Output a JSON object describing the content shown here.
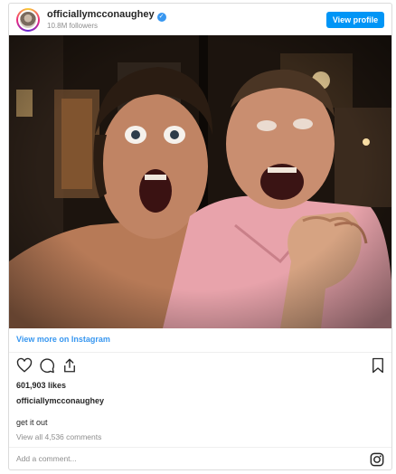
{
  "header": {
    "username": "officiallymcconaughey",
    "verified_mark": "✓",
    "followers": "10.8M followers",
    "view_profile_label": "View profile"
  },
  "post": {
    "view_more_label": "View more on Instagram",
    "likes": "601,903 likes",
    "caption_user": "officiallymcconaughey",
    "caption_text": "get it out",
    "comments_label": "View all 4,536 comments",
    "comment_placeholder": "Add a comment..."
  },
  "icons": {
    "like": "heart-icon",
    "comment": "comment-icon",
    "share": "share-icon",
    "save": "bookmark-icon",
    "instagram": "instagram-icon"
  },
  "colors": {
    "accent": "#0095f6",
    "link": "#3897f0",
    "text": "#262626",
    "muted": "#8e8e8e",
    "border": "#dbdbdb"
  }
}
